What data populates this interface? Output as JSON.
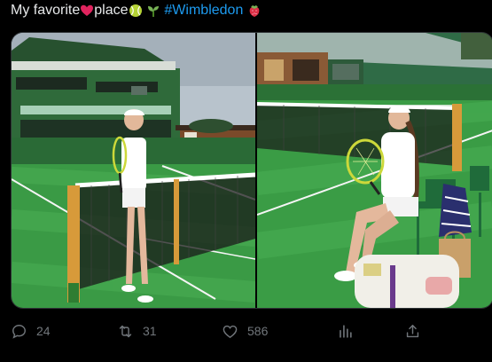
{
  "tweet": {
    "text_1": "My favorite",
    "text_2": "place",
    "hashtag": "#Wimbledon"
  },
  "media": {
    "left_photo_subject": "tennis-player-at-net",
    "right_photo_subject": "tennis-player-seated-courtside"
  },
  "actions": {
    "replies": "24",
    "reposts": "31",
    "likes": "586"
  },
  "colors": {
    "background": "#000000",
    "text": "#e7e9ea",
    "muted": "#71767b",
    "link": "#1d9bf0",
    "grass": "#2f8a3e",
    "grass_light": "#3fa24d",
    "building_green": "#2c6b39",
    "post_gold": "#d79a3a"
  }
}
